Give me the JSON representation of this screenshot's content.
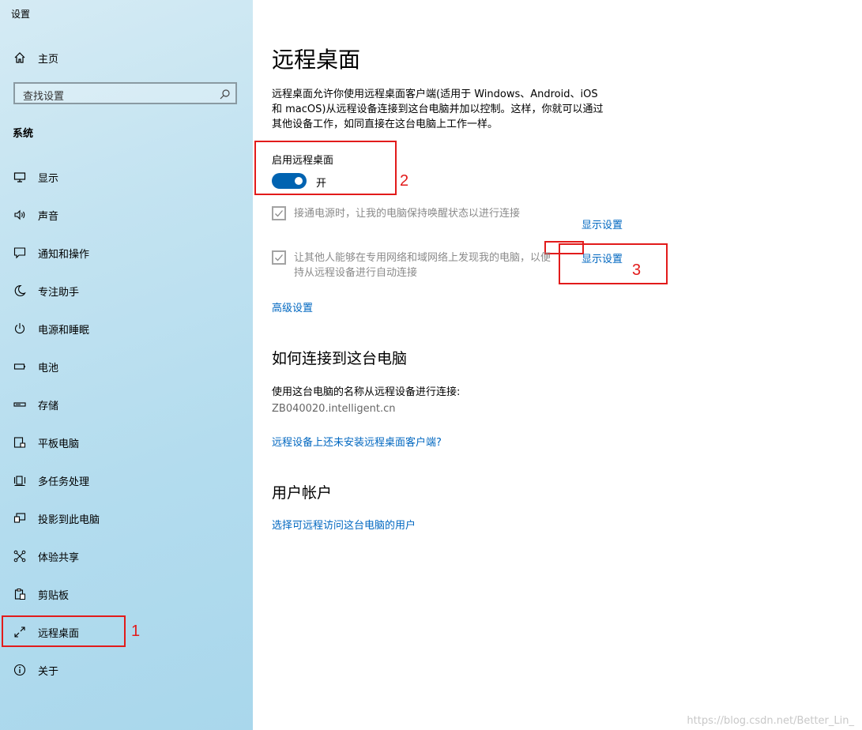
{
  "app_title": "设置",
  "home": {
    "label": "主页",
    "icon": "home-icon"
  },
  "search": {
    "placeholder": "查找设置",
    "icon": "search-icon"
  },
  "section_head": "系统",
  "nav": [
    {
      "label": "显示",
      "icon": "monitor-icon"
    },
    {
      "label": "声音",
      "icon": "speaker-icon"
    },
    {
      "label": "通知和操作",
      "icon": "message-icon"
    },
    {
      "label": "专注助手",
      "icon": "moon-icon"
    },
    {
      "label": "电源和睡眠",
      "icon": "power-icon"
    },
    {
      "label": "电池",
      "icon": "battery-icon"
    },
    {
      "label": "存储",
      "icon": "storage-icon"
    },
    {
      "label": "平板电脑",
      "icon": "tablet-icon"
    },
    {
      "label": "多任务处理",
      "icon": "multitask-icon"
    },
    {
      "label": "投影到此电脑",
      "icon": "project-icon"
    },
    {
      "label": "体验共享",
      "icon": "share-icon"
    },
    {
      "label": "剪贴板",
      "icon": "clipboard-icon"
    },
    {
      "label": "远程桌面",
      "icon": "remote-desktop-icon"
    },
    {
      "label": "关于",
      "icon": "info-icon"
    }
  ],
  "annotations": {
    "n1": "1",
    "n2": "2",
    "n3": "3"
  },
  "main": {
    "title": "远程桌面",
    "desc_line1": "远程桌面允许你使用远程桌面客户端(适用于 Windows、Android、iOS",
    "desc_line2": "和 macOS)从远程设备连接到这台电脑并加以控制。这样，你就可以通过",
    "desc_line3": "其他设备工作，如同直接在这台电脑上工作一样。",
    "enable_label": "启用远程桌面",
    "toggle_state": "开",
    "option1": "接通电源时，让我的电脑保持唤醒状态以进行连接",
    "option1_link": "显示设置",
    "option2_line1": "让其他人能够在专用网络和域网络上发现我的电脑，以便",
    "option2_line2": "持从远程设备进行自动连接",
    "option2_link": "显示设置",
    "advanced_link": "高级设置",
    "how_heading": "如何连接到这台电脑",
    "how_text": "使用这台电脑的名称从远程设备进行连接:",
    "pc_name": "ZB040020.intelligent.cn",
    "client_link": "远程设备上还未安装远程桌面客户端?",
    "accounts_heading": "用户帐户",
    "accounts_link": "选择可远程访问这台电脑的用户"
  },
  "watermark": "https://blog.csdn.net/Better_Lin_"
}
